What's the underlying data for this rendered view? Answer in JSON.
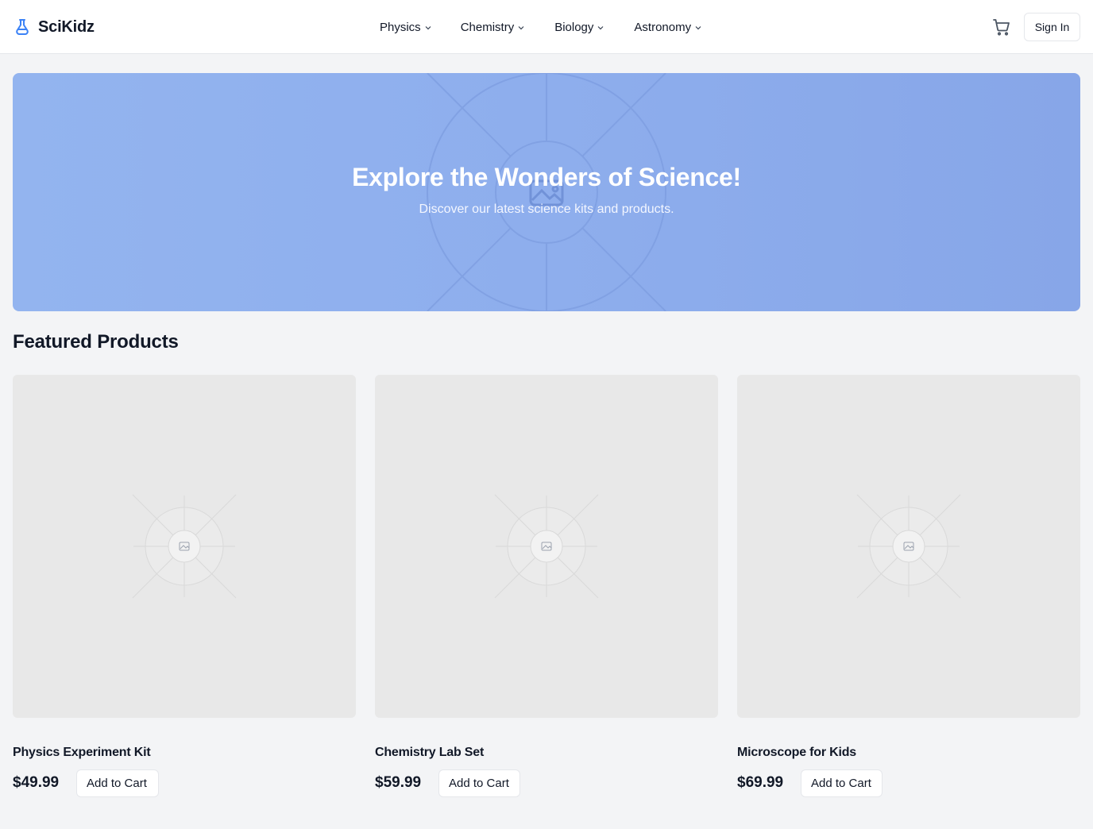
{
  "header": {
    "brand_name": "SciKidz",
    "brand_icon": "flask-icon",
    "nav": [
      {
        "label": "Physics",
        "icon": "chevron-down-icon"
      },
      {
        "label": "Chemistry",
        "icon": "chevron-down-icon"
      },
      {
        "label": "Biology",
        "icon": "chevron-down-icon"
      },
      {
        "label": "Astronomy",
        "icon": "chevron-down-icon"
      }
    ],
    "cart_icon": "cart-icon",
    "signin_label": "Sign In"
  },
  "hero": {
    "title": "Explore the Wonders of Science!",
    "subtitle": "Discover our latest science kits and products.",
    "image_icon": "image-placeholder-icon"
  },
  "featured": {
    "title": "Featured Products",
    "products": [
      {
        "name": "Physics Experiment Kit",
        "price": "$49.99",
        "button": "Add to Cart",
        "image_icon": "image-placeholder-icon"
      },
      {
        "name": "Chemistry Lab Set",
        "price": "$59.99",
        "button": "Add to Cart",
        "image_icon": "image-placeholder-icon"
      },
      {
        "name": "Microscope for Kids",
        "price": "$69.99",
        "button": "Add to Cart",
        "image_icon": "image-placeholder-icon"
      }
    ]
  },
  "colors": {
    "accent": "#3b82f6",
    "hero_bg": "#8eaeed",
    "page_bg": "#f3f4f6",
    "placeholder_bg": "#e8e8e8"
  }
}
